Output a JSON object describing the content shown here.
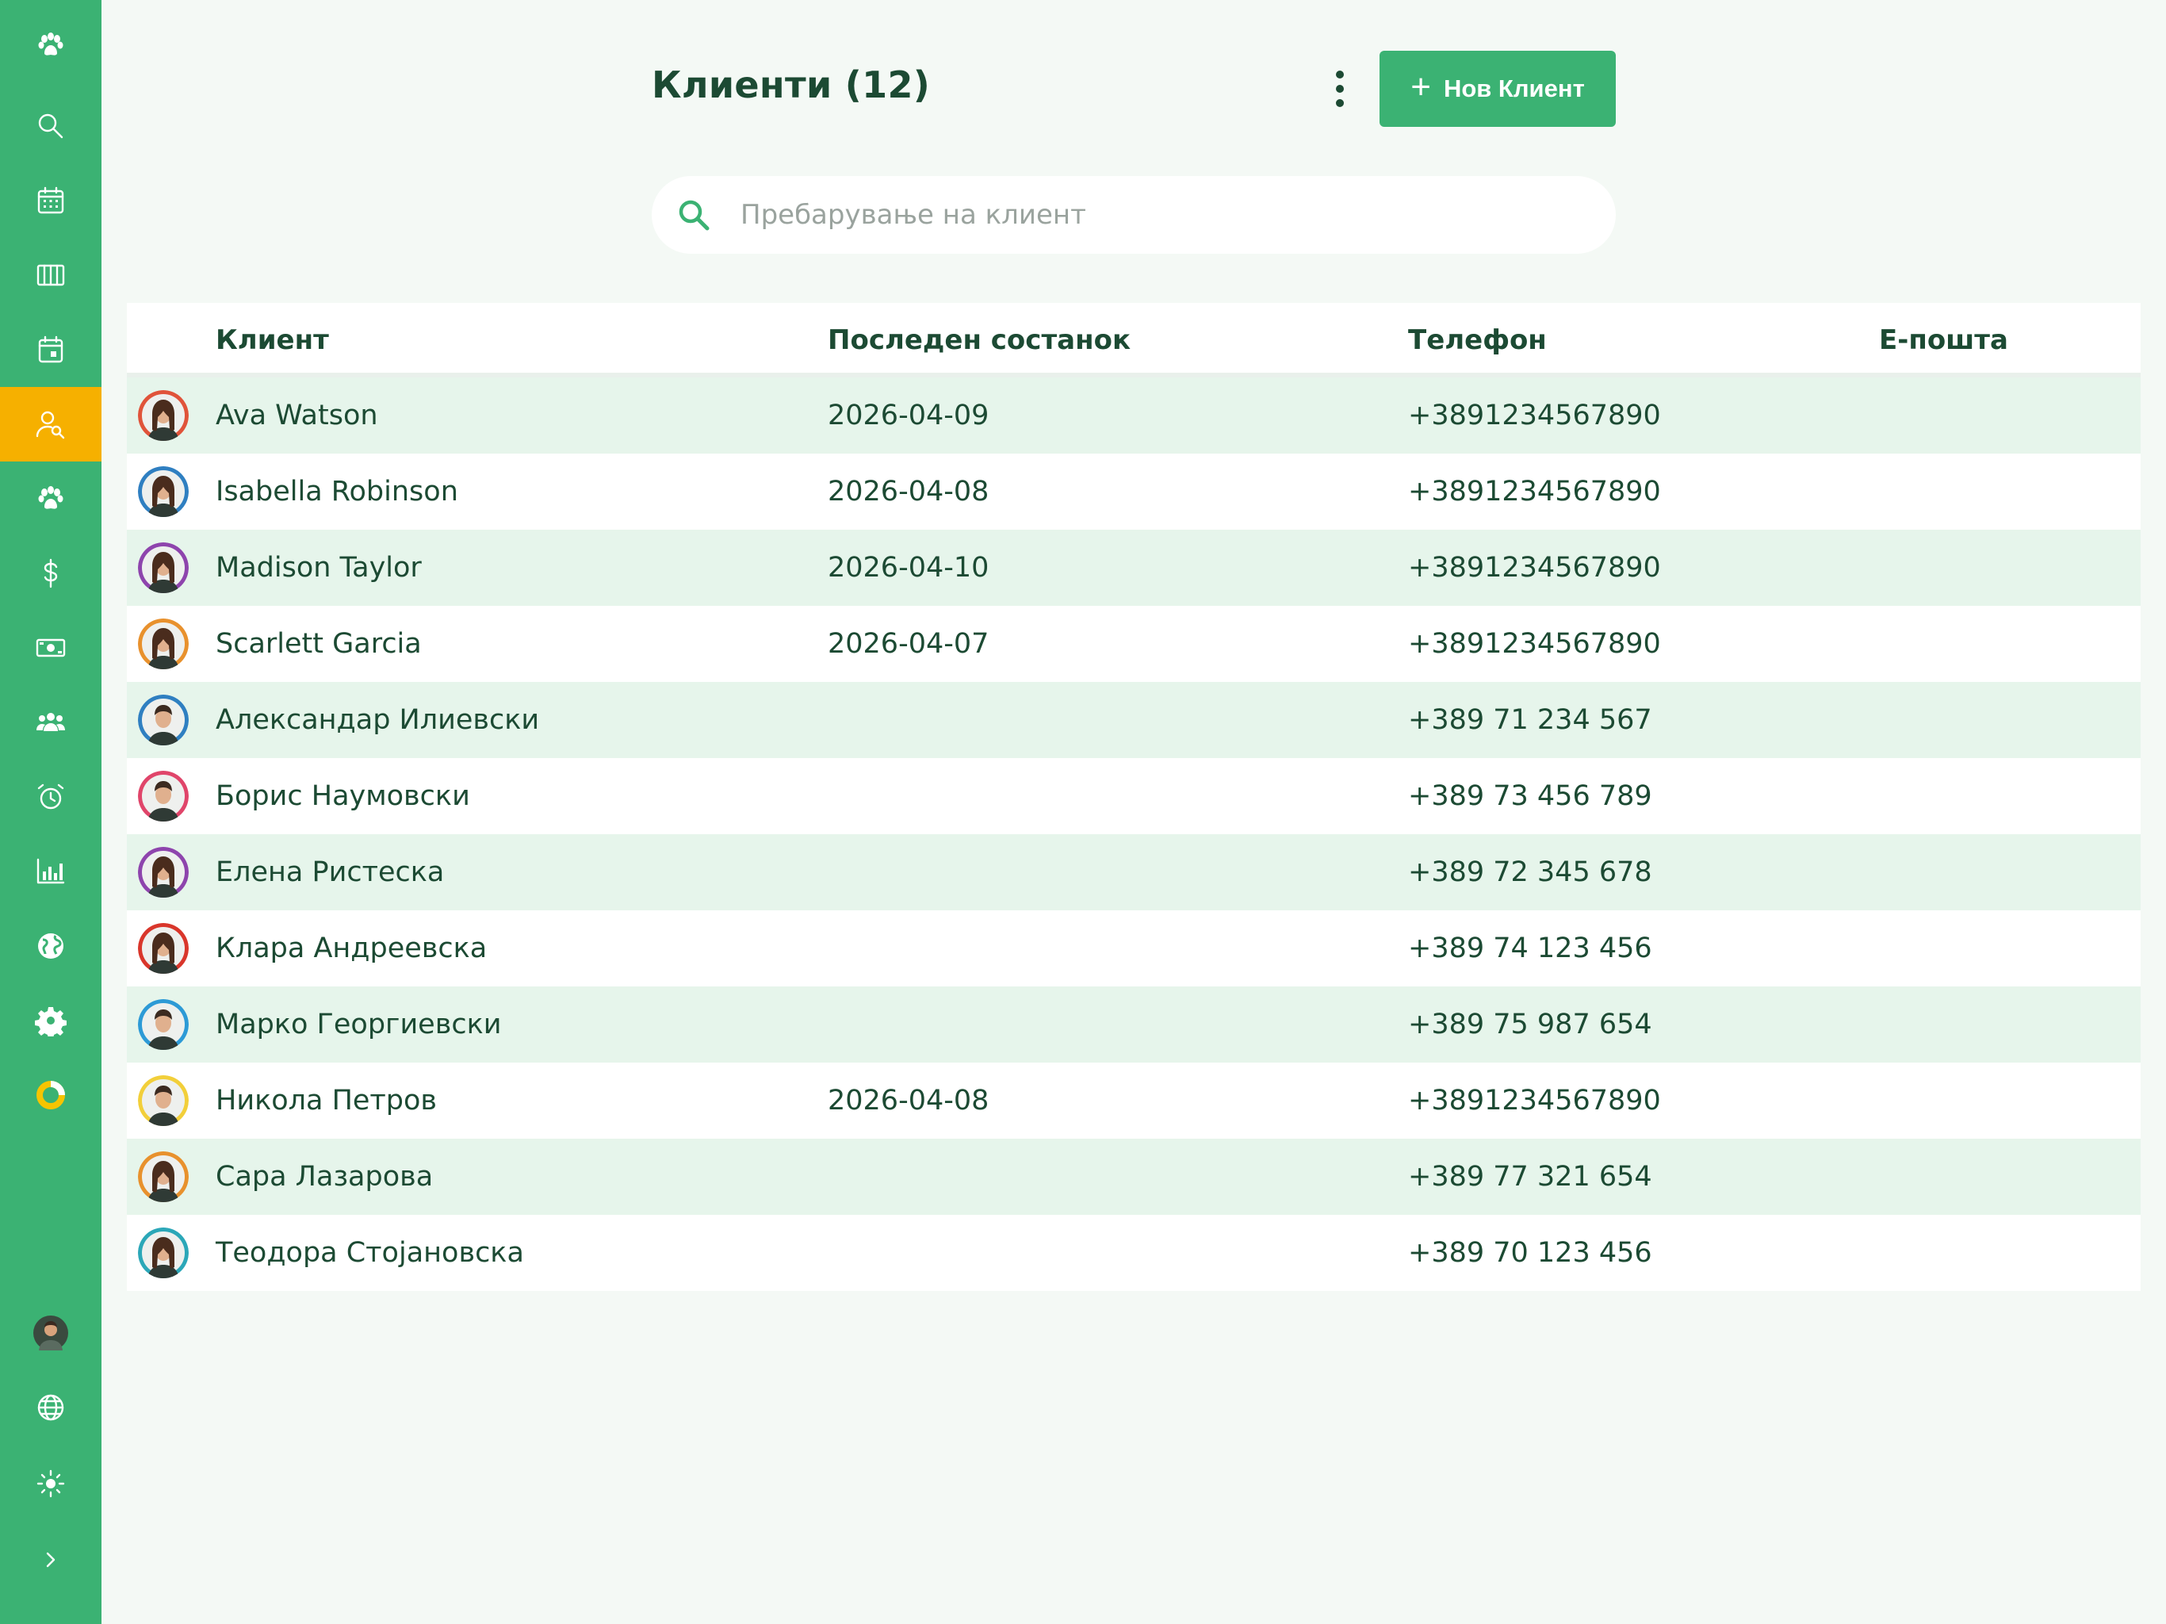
{
  "colors": {
    "sidebar": "#3bb273",
    "active_nav": "#f6b000",
    "primary_button": "#3bb273",
    "row_alt": "#e6f5eb",
    "text": "#1c4a33"
  },
  "sidebar": {
    "items": [
      {
        "icon": "paw-icon"
      },
      {
        "icon": "search-icon"
      },
      {
        "icon": "calendar-icon"
      },
      {
        "icon": "columns-icon"
      },
      {
        "icon": "calendar-day-icon"
      },
      {
        "icon": "user-search-icon",
        "active": true
      },
      {
        "icon": "paw-icon"
      },
      {
        "icon": "dollar-icon"
      },
      {
        "icon": "cash-icon"
      },
      {
        "icon": "users-icon"
      },
      {
        "icon": "alarm-icon"
      },
      {
        "icon": "bar-chart-icon"
      },
      {
        "icon": "globe-icon"
      },
      {
        "icon": "gear-icon"
      },
      {
        "icon": "ring-chart-icon"
      }
    ],
    "bottom": [
      {
        "icon": "user-avatar"
      },
      {
        "icon": "language-globe-icon"
      },
      {
        "icon": "sun-icon"
      },
      {
        "icon": "chevron-right-icon"
      }
    ]
  },
  "header": {
    "title": "Клиенти (12)",
    "new_client_label": "Нов Клиент"
  },
  "search": {
    "placeholder": "Пребарување на клиент",
    "value": ""
  },
  "table": {
    "columns": [
      "Клиент",
      "Последен состанок",
      "Телефон",
      "Е-пошта"
    ],
    "rows": [
      {
        "name": "Ava Watson",
        "last_meeting": "2026-04-09",
        "phone": "+3891234567890",
        "email": "",
        "ring": "#e0533a",
        "gender": "f"
      },
      {
        "name": "Isabella Robinson",
        "last_meeting": "2026-04-08",
        "phone": "+3891234567890",
        "email": "",
        "ring": "#2f7fc1",
        "gender": "f"
      },
      {
        "name": "Madison Taylor",
        "last_meeting": "2026-04-10",
        "phone": "+3891234567890",
        "email": "",
        "ring": "#8e44ad",
        "gender": "f"
      },
      {
        "name": "Scarlett Garcia",
        "last_meeting": "2026-04-07",
        "phone": "+3891234567890",
        "email": "",
        "ring": "#e8912d",
        "gender": "f"
      },
      {
        "name": "Александар Илиевски",
        "last_meeting": "",
        "phone": "+389 71 234 567",
        "email": "",
        "ring": "#2f7fc1",
        "gender": "m"
      },
      {
        "name": "Борис Наумовски",
        "last_meeting": "",
        "phone": "+389 73 456 789",
        "email": "",
        "ring": "#e0456a",
        "gender": "m"
      },
      {
        "name": "Елена Ристеска",
        "last_meeting": "",
        "phone": "+389 72 345 678",
        "email": "",
        "ring": "#8e44ad",
        "gender": "f"
      },
      {
        "name": "Клара Андреевска",
        "last_meeting": "",
        "phone": "+389 74 123 456",
        "email": "",
        "ring": "#d9362b",
        "gender": "f"
      },
      {
        "name": "Марко Георгиевски",
        "last_meeting": "",
        "phone": "+389 75 987 654",
        "email": "",
        "ring": "#2d9ad6",
        "gender": "m"
      },
      {
        "name": "Никола Петров",
        "last_meeting": "2026-04-08",
        "phone": "+3891234567890",
        "email": "",
        "ring": "#f2cf3a",
        "gender": "m"
      },
      {
        "name": "Сара Лазарова",
        "last_meeting": "",
        "phone": "+389 77 321 654",
        "email": "",
        "ring": "#e8912d",
        "gender": "f"
      },
      {
        "name": "Теодора Стојановска",
        "last_meeting": "",
        "phone": "+389 70 123 456",
        "email": "",
        "ring": "#2ba7b8",
        "gender": "f"
      }
    ]
  }
}
